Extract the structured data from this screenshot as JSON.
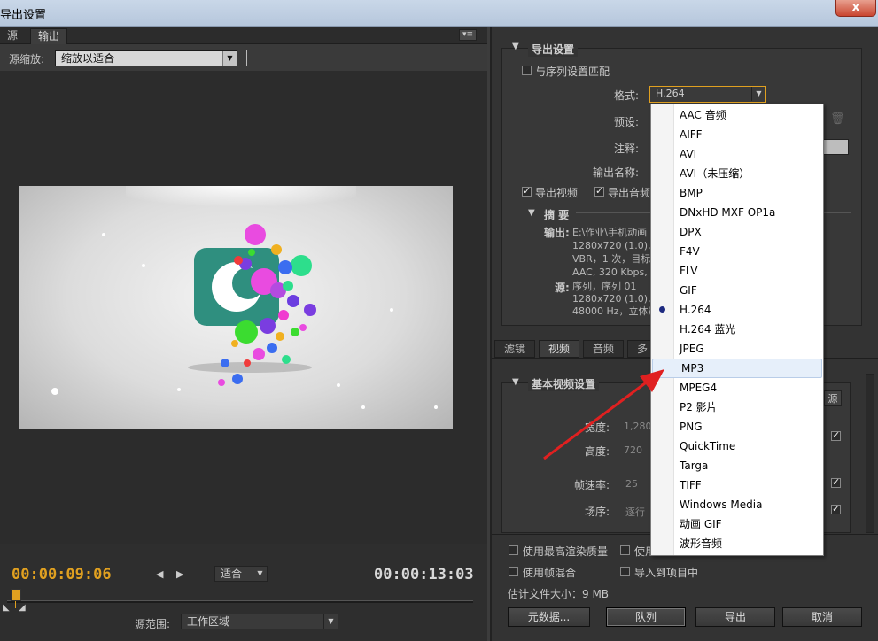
{
  "window": {
    "title": "导出设置",
    "close_glyph": "x"
  },
  "left": {
    "tabs": [
      "源",
      "输出"
    ],
    "zoom_label": "源缩放:",
    "zoom_value": "缩放以适合",
    "current_time": "00:00:09:06",
    "fit_value": "适合",
    "duration": "00:00:13:03",
    "range_label": "源范围:",
    "range_value": "工作区域"
  },
  "export": {
    "section_title": "导出设置",
    "match_sequence": "与序列设置匹配",
    "format_label": "格式:",
    "format_value": "H.264",
    "preset_label": "预设:",
    "comment_label": "注释:",
    "output_name_label": "输出名称:",
    "export_video": "导出视频",
    "export_audio": "导出音频",
    "summary_title": "摘 要",
    "output_label": "输出:",
    "output_lines": [
      "E:\\作业\\手机动画",
      "1280x720 (1.0),",
      "VBR，1 次，目标",
      "AAC, 320 Kbps, 4"
    ],
    "source_label": "源:",
    "source_lines": [
      "序列，序列 01",
      "1280x720 (1.0),",
      "48000 Hz，立体声"
    ]
  },
  "right_tabs": [
    "滤镜",
    "视频",
    "音频",
    "多"
  ],
  "video": {
    "section_title": "基本视频设置",
    "width_label": "宽度:",
    "width_value": "1,280",
    "height_label": "高度:",
    "height_value": "720",
    "fps_label": "帧速率:",
    "fps_value": "25",
    "field_label": "场序:",
    "field_value": "逐行"
  },
  "bottom": {
    "max_quality": "使用最高渲染质量",
    "use_preview": "使用",
    "frame_blend": "使用帧混合",
    "import_project": "导入到项目中",
    "file_size": "估计文件大小：9 MB",
    "metadata_btn": "元数据...",
    "queue_btn": "队列",
    "export_btn": "导出",
    "cancel_btn": "取消"
  },
  "format_menu": {
    "items": [
      "AAC 音频",
      "AIFF",
      "AVI",
      "AVI（未压缩）",
      "BMP",
      "DNxHD MXF OP1a",
      "DPX",
      "F4V",
      "FLV",
      "GIF",
      "H.264",
      "H.264 蓝光",
      "JPEG",
      "MP3",
      "MPEG4",
      "P2 影片",
      "PNG",
      "QuickTime",
      "Targa",
      "TIFF",
      "Windows Media",
      "动画 GIF",
      "波形音频"
    ],
    "selected_index": 10,
    "highlighted_index": 13
  },
  "colors": {
    "accent_time": "#e0a020",
    "arrow": "#e02020",
    "menu_highlight": "#e6effa"
  }
}
